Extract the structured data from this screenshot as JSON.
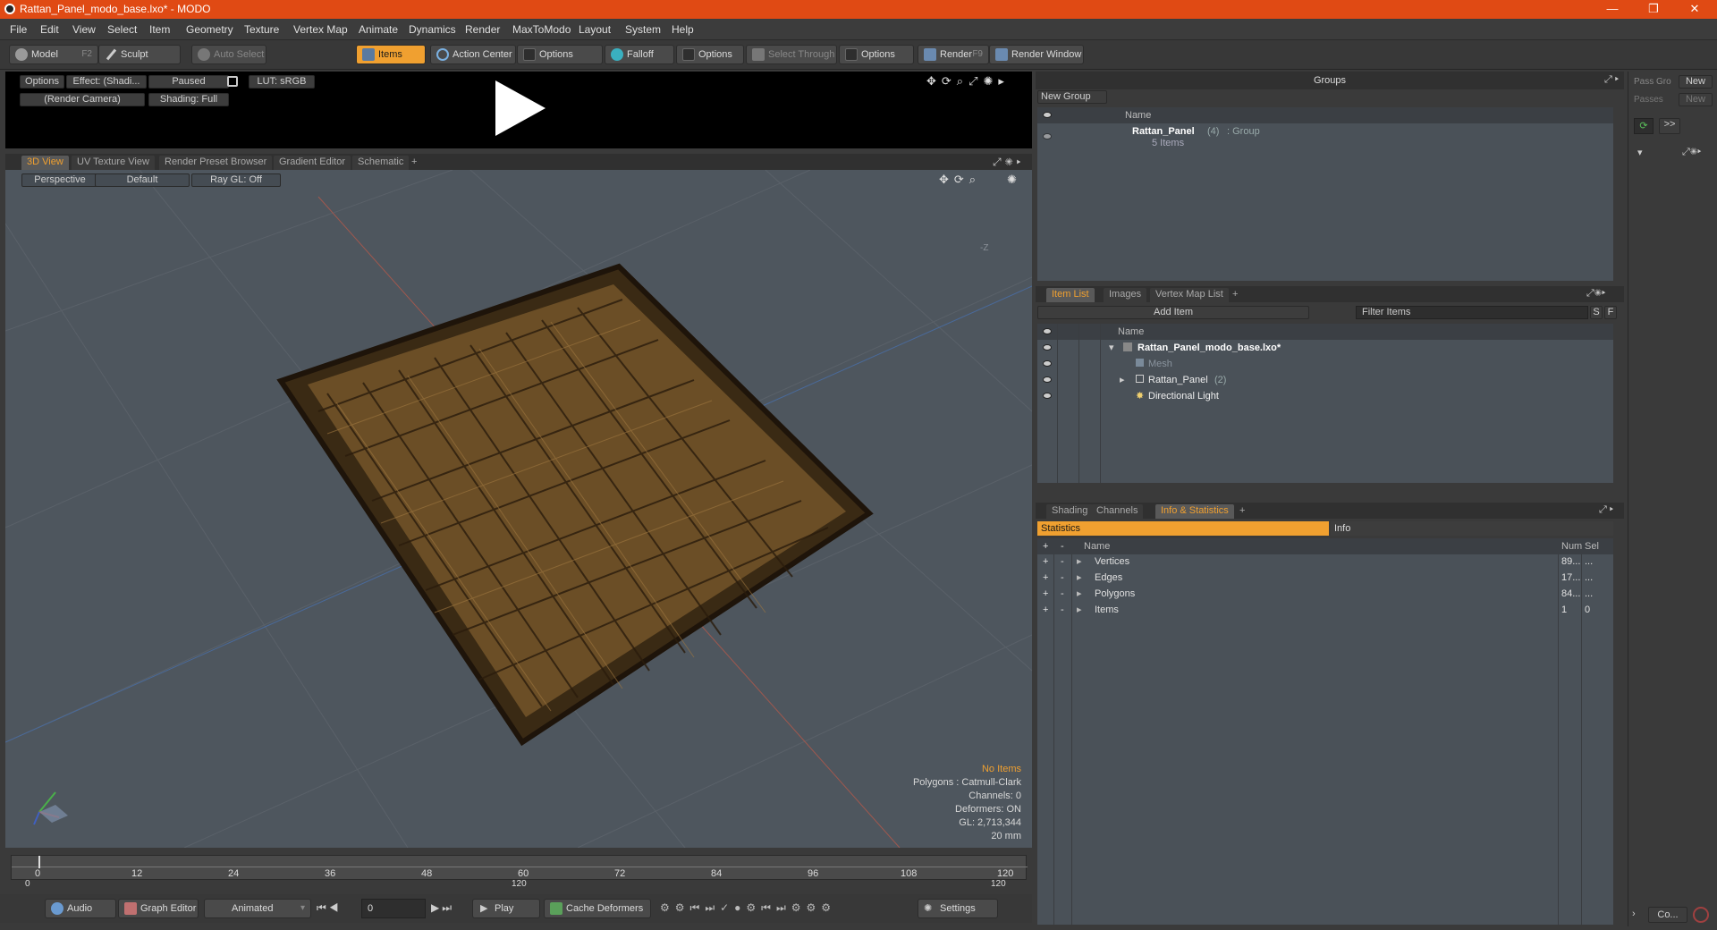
{
  "window": {
    "title": "Rattan_Panel_modo_base.lxo* - MODO",
    "controls": [
      "—",
      "❐",
      "✕"
    ]
  },
  "menu": [
    "File",
    "Edit",
    "View",
    "Select",
    "Item",
    "Geometry",
    "Texture",
    "Vertex Map",
    "Animate",
    "Dynamics",
    "Render",
    "MaxToModo",
    "Layout",
    "System",
    "Help"
  ],
  "toolbar": {
    "model": "Model",
    "model_key": "F2",
    "sculpt": "Sculpt",
    "auto_select": "Auto Select",
    "items": "Items",
    "action_center": "Action Center",
    "options1": "Options",
    "falloff": "Falloff",
    "options2": "Options",
    "select_through": "Select Through",
    "options3": "Options",
    "render": "Render",
    "render_key": "F9",
    "render_window": "Render Window"
  },
  "preview": {
    "options": "Options",
    "effect": "Effect: (Shadi...",
    "paused": "Paused",
    "lut": "LUT: sRGB",
    "camera": "(Render Camera)",
    "shading": "Shading: Full"
  },
  "viewport_tabs": [
    "3D View",
    "UV Texture View",
    "Render Preset Browser",
    "Gradient Editor",
    "Schematic",
    "+"
  ],
  "viewport": {
    "perspective": "Perspective",
    "default": "Default",
    "raygl": "Ray GL: Off",
    "axis_z": "-Z",
    "overlay": [
      "No Items",
      "Polygons : Catmull-Clark",
      "Channels: 0",
      "Deformers: ON",
      "GL: 2,713,344",
      "20 mm"
    ]
  },
  "timeline": {
    "ticks": [
      "0",
      "12",
      "24",
      "36",
      "48",
      "60",
      "72",
      "84",
      "96",
      "108",
      "120"
    ],
    "range_start": "0",
    "range_mid": "120",
    "range_end": "120"
  },
  "bottombar": {
    "audio": "Audio",
    "graph_editor": "Graph Editor",
    "animated": "Animated",
    "frame": "0",
    "play": "Play",
    "cache": "Cache Deformers",
    "settings": "Settings"
  },
  "groups": {
    "title": "Groups",
    "new_group": "New Group",
    "col_name": "Name",
    "item_name": "Rattan_Panel",
    "item_count": "(4)",
    "item_type": ": Group",
    "item_sub": "5 Items"
  },
  "itemlist": {
    "tabs": [
      "Item List",
      "Images",
      "Vertex Map List",
      "+"
    ],
    "add_item": "Add Item",
    "filter": "Filter Items",
    "s": "S",
    "f": "F",
    "col_name": "Name",
    "rows": [
      {
        "label": "Rattan_Panel_modo_base.lxo*",
        "extra": ""
      },
      {
        "label": "Mesh",
        "extra": ""
      },
      {
        "label": "Rattan_Panel",
        "extra": "(2)"
      },
      {
        "label": "Directional Light",
        "extra": ""
      }
    ]
  },
  "stats": {
    "tabs": [
      "Shading",
      "Channels",
      "Info & Statistics",
      "+"
    ],
    "statistics": "Statistics",
    "info": "Info",
    "cols": {
      "plus": "+",
      "minus": "-",
      "name": "Name",
      "num": "Num",
      "sel": "Sel"
    },
    "rows": [
      {
        "name": "Vertices",
        "num": "89...",
        "sel": "..."
      },
      {
        "name": "Edges",
        "num": "17...",
        "sel": "..."
      },
      {
        "name": "Polygons",
        "num": "84...",
        "sel": "..."
      },
      {
        "name": "Items",
        "num": "1",
        "sel": "0"
      }
    ]
  },
  "passes": {
    "pass_group": "Pass Gro",
    "passes": "Passes",
    "new1": "New",
    "new2": "New",
    "arrow": ">>",
    "co": "Co..."
  }
}
